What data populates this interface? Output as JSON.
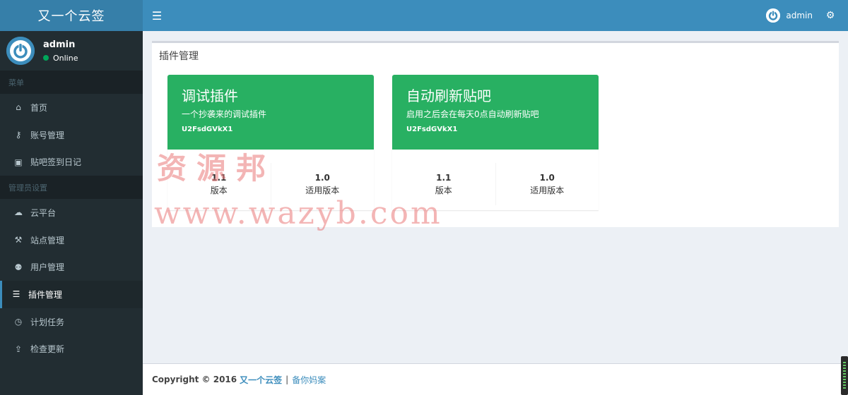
{
  "app": {
    "logo": "又一个云签"
  },
  "user": {
    "name": "admin",
    "status": "Online"
  },
  "sidebar": {
    "header1": "菜单",
    "header2": "管理员设置",
    "items": [
      {
        "label": "首页",
        "icon": "home-icon"
      },
      {
        "label": "账号管理",
        "icon": "key-icon"
      },
      {
        "label": "贴吧签到日记",
        "icon": "calendar-check-icon"
      },
      {
        "label": "云平台",
        "icon": "cloud-icon"
      },
      {
        "label": "站点管理",
        "icon": "wrench-icon"
      },
      {
        "label": "用户管理",
        "icon": "users-icon"
      },
      {
        "label": "插件管理",
        "icon": "list-icon"
      },
      {
        "label": "计划任务",
        "icon": "clock-icon"
      },
      {
        "label": "检查更新",
        "icon": "upload-icon"
      }
    ]
  },
  "topbar": {
    "username": "admin"
  },
  "box": {
    "title": "插件管理"
  },
  "plugins": [
    {
      "title": "调试插件",
      "desc": "一个抄袭来的调试插件",
      "code": "U2FsdGVkX1",
      "version": "1.1",
      "version_label": "版本",
      "compat": "1.0",
      "compat_label": "适用版本"
    },
    {
      "title": "自动刷新贴吧",
      "desc": "启用之后会在每天0点自动刷新贴吧",
      "code": "U2FsdGVkX1",
      "version": "1.1",
      "version_label": "版本",
      "compat": "1.0",
      "compat_label": "适用版本"
    }
  ],
  "watermark": {
    "cn": "资源邦",
    "url": "www.wazyb.com"
  },
  "footer": {
    "copyright": "Copyright © 2016",
    "brand": "又一个云签",
    "sep": "|",
    "icp": "备你妈案"
  },
  "colors": {
    "primary": "#3c8dbc",
    "sidebar": "#222d32",
    "success": "#28b062"
  }
}
